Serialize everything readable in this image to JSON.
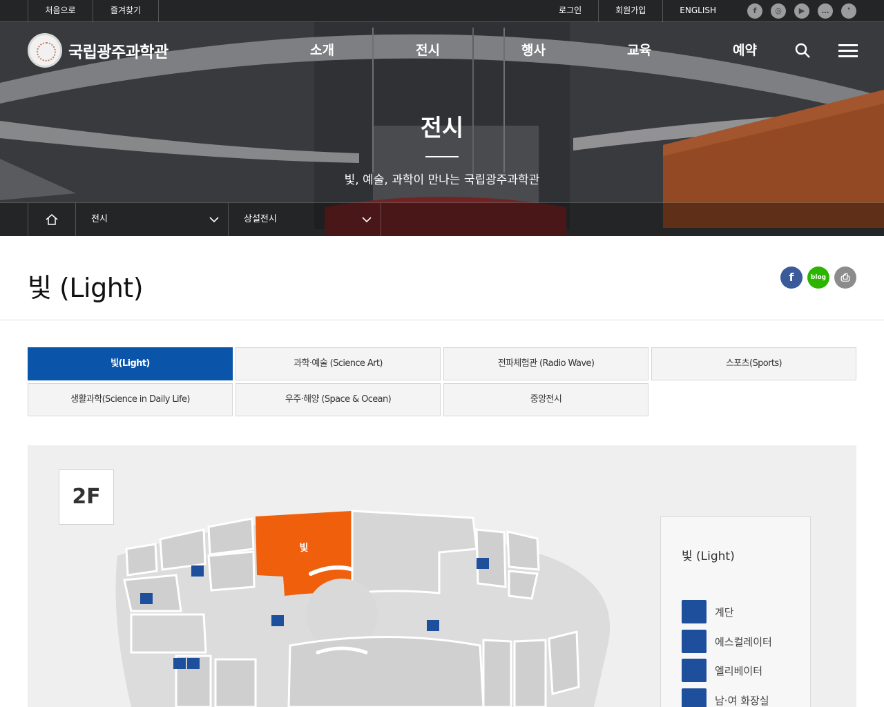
{
  "utility": {
    "links_left": [
      "처음으로",
      "즐겨찾기"
    ],
    "links_right": [
      "로그인",
      "회원가입",
      "ENGLISH"
    ],
    "sns": [
      "facebook-icon",
      "instagram-icon",
      "youtube-icon",
      "talk-icon",
      "blog-icon"
    ]
  },
  "header": {
    "logo_text": "국립광주과학관",
    "menu": [
      "소개",
      "전시",
      "행사",
      "교육",
      "예약"
    ]
  },
  "hero": {
    "title": "전시",
    "subtitle": "빛, 예술, 과학이 만나는 국립광주과학관"
  },
  "breadcrumb": {
    "level1": "전시",
    "level2": "상설전시"
  },
  "page": {
    "title": "빛 (Light)"
  },
  "share": [
    {
      "icon": "facebook-icon",
      "glyph": "f",
      "color": "#3b5a9a"
    },
    {
      "icon": "blog-icon",
      "glyph": "blog",
      "color": "#2db400"
    },
    {
      "icon": "print-icon",
      "glyph": "⎙",
      "color": "#8c8c8c"
    }
  ],
  "tabs": [
    {
      "label": "빛(Light)",
      "active": true
    },
    {
      "label": "과학·예술 (Science Art)",
      "active": false
    },
    {
      "label": "전파체험관 (Radio Wave)",
      "active": false
    },
    {
      "label": "스포츠(Sports)",
      "active": false
    },
    {
      "label": "생활과학(Science in Daily Life)",
      "active": false
    },
    {
      "label": "우주·해양 (Space & Ocean)",
      "active": false
    },
    {
      "label": "중앙전시",
      "active": false
    }
  ],
  "map": {
    "floor": "2F",
    "highlight_label": "빛",
    "highlight_color": "#ef5f0c",
    "legend_title": "빛 (Light)",
    "legend": [
      {
        "label": "계단",
        "icon": "stairs-icon"
      },
      {
        "label": "에스컬레이터",
        "icon": "escalator-icon"
      },
      {
        "label": "엘리베이터",
        "icon": "elevator-icon"
      },
      {
        "label": "남·여 화장실",
        "icon": "restroom-icon"
      }
    ]
  },
  "colors": {
    "accent_blue": "#0a55aa",
    "legend_icon_blue": "#1d4f9c"
  }
}
